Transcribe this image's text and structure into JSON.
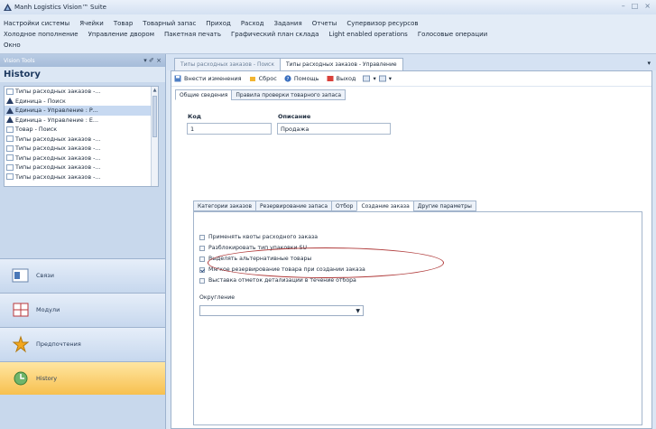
{
  "app": {
    "title": "Manh Logistics Vision™ Suite"
  },
  "window_controls": {
    "minimize": "–",
    "maximize": "□",
    "close": "×"
  },
  "menu": {
    "row1": [
      "Настройки системы",
      "Ячейки",
      "Товар",
      "Товарный запас",
      "Приход",
      "Расход",
      "Задания",
      "Отчеты",
      "Супервизор ресурсов"
    ],
    "row2": [
      "Холодное пополнение",
      "Управление двором",
      "Пакетная печать",
      "Графический план склада",
      "Light enabled operations",
      "Голосовые операции"
    ],
    "row3": [
      "Окно"
    ]
  },
  "sidebar": {
    "panel_title": "Vision Tools",
    "panel_controls": "▾ ✐ ×",
    "history_title": "History",
    "history_items": [
      {
        "label": "Типы расходных заказов -...",
        "icon": "doc"
      },
      {
        "label": "Единица - Поиск",
        "icon": "warn"
      },
      {
        "label": "Единица - Управление : Р...",
        "icon": "warn"
      },
      {
        "label": "Единица - Управление : Е...",
        "icon": "warn"
      },
      {
        "label": "Товар - Поиск",
        "icon": "doc"
      },
      {
        "label": "Типы расходных заказов -...",
        "icon": "doc"
      },
      {
        "label": "Типы расходных заказов -...",
        "icon": "doc"
      },
      {
        "label": "Типы расходных заказов -...",
        "icon": "doc"
      },
      {
        "label": "Типы расходных заказов -...",
        "icon": "doc"
      },
      {
        "label": "Типы расходных заказов -...",
        "icon": "doc"
      }
    ],
    "nav": {
      "links": "Связи",
      "modules": "Модули",
      "preferences": "Предпочтения",
      "history": "History"
    }
  },
  "doc_tabs": [
    {
      "label": "Типы расходных заказов - Поиск"
    },
    {
      "label": "Типы расходных заказов - Управление"
    }
  ],
  "toolbar": {
    "apply": "Внести изменения",
    "reset": "Сброс",
    "help": "Помощь",
    "exit": "Выход"
  },
  "tabs": [
    "Общие сведения",
    "Правила проверки товарного запаса"
  ],
  "form": {
    "code_label": "Код",
    "desc_label": "Описание",
    "code_value": "1",
    "desc_value": "Продажа"
  },
  "subtabs": [
    "Категории заказов",
    "Резервирование запаса",
    "Отбор",
    "Создание заказа",
    "Другие параметры"
  ],
  "options": [
    {
      "label": "Применять квоты расходного заказа",
      "checked": false
    },
    {
      "label": "Разблокировать тип упаковки SU",
      "checked": false
    },
    {
      "label": "Выделять альтернативные товары",
      "checked": false
    },
    {
      "label": "Мягкое резервирование товара при создании заказа",
      "checked": true
    },
    {
      "label": "Выставка отметок детализации в течение отбора",
      "checked": false
    }
  ],
  "rounding": {
    "label": "Округление",
    "value": "",
    "arrow": "▼"
  },
  "colors": {
    "accent": "#f7c04f",
    "annotation": "#b03b3b"
  }
}
